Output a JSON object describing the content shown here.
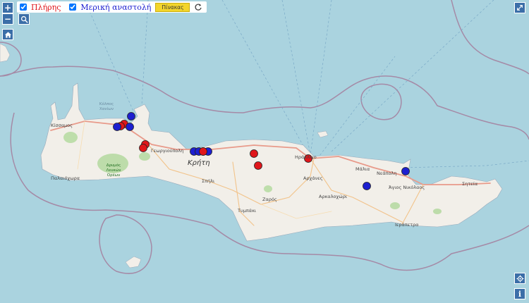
{
  "toolbar": {
    "full_label": "Πλήρης",
    "partial_label": "Μερική αναστολή",
    "table_button": "Πίνακας"
  },
  "controls": {
    "zoom_in": "+",
    "zoom_out": "−",
    "search_icon": "search-icon",
    "home_icon": "home-icon",
    "reload_icon": "reload-icon",
    "fullscreen_icon": "fullscreen-icon",
    "locate_icon": "locate-icon",
    "info_icon": "info-icon"
  },
  "colors": {
    "full": "#e0161b",
    "partial": "#1d1fd0",
    "sea": "#aad3df",
    "land": "#f2efe9"
  },
  "labels": {
    "island": "Κρήτη",
    "kissamos": "Κίσσαμος",
    "kolpos": "Κόλπος\nΧανίων",
    "georgioupoli": "Γεωργιούπολη",
    "palaiochora": "Παλαιόχωρα",
    "drymos": "Δρυμός\nΛευκών\nΟρέων",
    "spili": "Σπήλι",
    "tympaki": "Τυμπάκι",
    "zaros": "Ζαρός",
    "archanes": "Αρχάνες",
    "arkalochori": "Αρκαλοχώρι",
    "heraklion": "Ηράκλειο",
    "malia": "Μάλια",
    "neapoli": "Νεάπολη",
    "agios_nikolaos": "Άγιος Νικόλαος",
    "ierapetra": "Ιεράπετρα",
    "siteia": "Σητεία"
  }
}
